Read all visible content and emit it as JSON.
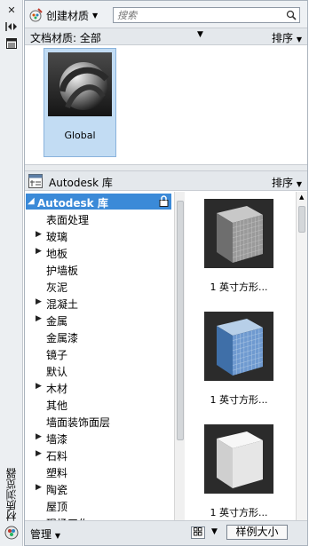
{
  "sidebar": {
    "vertical_title": "材质浏览器"
  },
  "toolbar": {
    "create_label": "创建材质",
    "search_placeholder": "搜索"
  },
  "document_materials": {
    "label": "文档材质: 全部",
    "sort_label": "排序",
    "items": [
      {
        "name": "Global"
      }
    ]
  },
  "library": {
    "header_title": "Autodesk 库",
    "sort_label": "排序",
    "root_label": "Autodesk 库",
    "categories": [
      {
        "label": "表面处理",
        "expandable": false
      },
      {
        "label": "玻璃",
        "expandable": true
      },
      {
        "label": "地板",
        "expandable": true
      },
      {
        "label": "护墙板",
        "expandable": false
      },
      {
        "label": "灰泥",
        "expandable": false
      },
      {
        "label": "混凝土",
        "expandable": true
      },
      {
        "label": "金属",
        "expandable": true
      },
      {
        "label": "金属漆",
        "expandable": false
      },
      {
        "label": "镜子",
        "expandable": false
      },
      {
        "label": "默认",
        "expandable": false
      },
      {
        "label": "木材",
        "expandable": true
      },
      {
        "label": "其他",
        "expandable": false
      },
      {
        "label": "墙面装饰面层",
        "expandable": false
      },
      {
        "label": "墙漆",
        "expandable": true
      },
      {
        "label": "石料",
        "expandable": true
      },
      {
        "label": "塑料",
        "expandable": false
      },
      {
        "label": "陶瓷",
        "expandable": true
      },
      {
        "label": "屋顶",
        "expandable": false
      },
      {
        "label": "现场工作",
        "expandable": false
      }
    ],
    "swatches": [
      {
        "caption": "1 英寸方形...",
        "colors": [
          "#9a9a9a",
          "#6e6e6e",
          "#c8c8c8"
        ]
      },
      {
        "caption": "1 英寸方形...",
        "colors": [
          "#6f9ad0",
          "#3f6fa8",
          "#b7cfe8"
        ]
      },
      {
        "caption": "1 英寸方形...",
        "colors": [
          "#e6e6e6",
          "#cfcfcf",
          "#f7f7f7"
        ]
      }
    ]
  },
  "bottom": {
    "manage_label": "管理",
    "size_label": "样例大小"
  }
}
